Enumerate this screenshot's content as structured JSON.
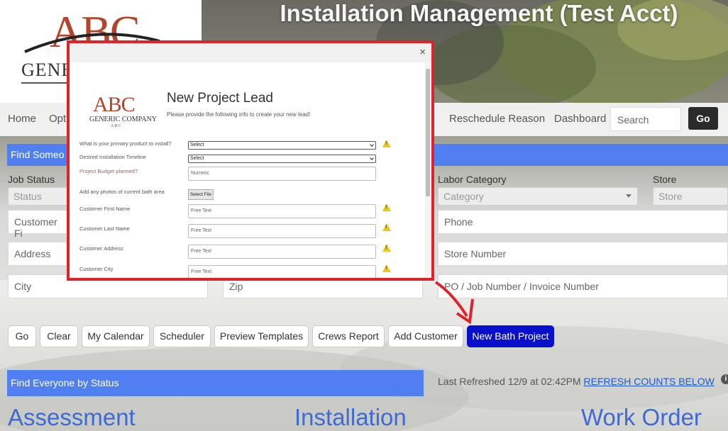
{
  "header": {
    "title": "Installation Management (Test Acct)",
    "logo_main": "ABC",
    "logo_sub": "GENE"
  },
  "nav": {
    "items": [
      "Home",
      "Opt",
      "Reschedule Reason",
      "Dashboard"
    ],
    "search_placeholder": "Search",
    "go_label": "Go"
  },
  "find_bar": {
    "label": "Find Someo"
  },
  "filters": {
    "job_status_label": "Job Status",
    "job_status_value": "Status",
    "labor_category_label": "Labor Category",
    "labor_category_value": "Category",
    "store_label": "Store",
    "store_value": "Store",
    "customer_first": "Customer Fi",
    "address": "Address",
    "city": "City",
    "zip": "Zip",
    "phone": "Phone",
    "store_number": "Store Number",
    "po_number": "PO / Job Number / Invoice Number"
  },
  "actions": [
    "Go",
    "Clear",
    "My Calendar",
    "Scheduler",
    "Preview Templates",
    "Crews Report",
    "Add Customer",
    "New Bath Project"
  ],
  "status_section": {
    "bar_label": "Find Everyone by Status",
    "refresh_prefix": "Last Refreshed 12/9 at 02:42PM ",
    "refresh_link": "REFRESH COUNTS BELOW",
    "headings": [
      "Assessment",
      "Installation",
      "Work Order"
    ]
  },
  "modal": {
    "close": "×",
    "logo_main": "ABC",
    "logo_company": "GENERIC COMPANY",
    "logo_small": "A B C",
    "title": "New Project Lead",
    "subtitle": "Please provide the following info to create your new lead!",
    "q_product": "What is your primary product to install?",
    "q_product_value": "Select",
    "q_timeline": "Desired Installation Timeline",
    "q_timeline_value": "Select",
    "q_budget": "Project Budget planned?",
    "q_budget_placeholder": "Numeric",
    "q_photos": "Add any photos of current bath area",
    "q_photos_button": "Select File",
    "q_first": "Customer First Name",
    "q_last": "Customer Last Name",
    "q_address": "Customer Address",
    "q_city": "Customer City",
    "free_text": "Free Text"
  },
  "colors": {
    "accent_blue": "#4f7ff0",
    "primary_button": "#0a0fcc",
    "highlight_red": "#e0232a",
    "warning_yellow": "#f0c419"
  }
}
